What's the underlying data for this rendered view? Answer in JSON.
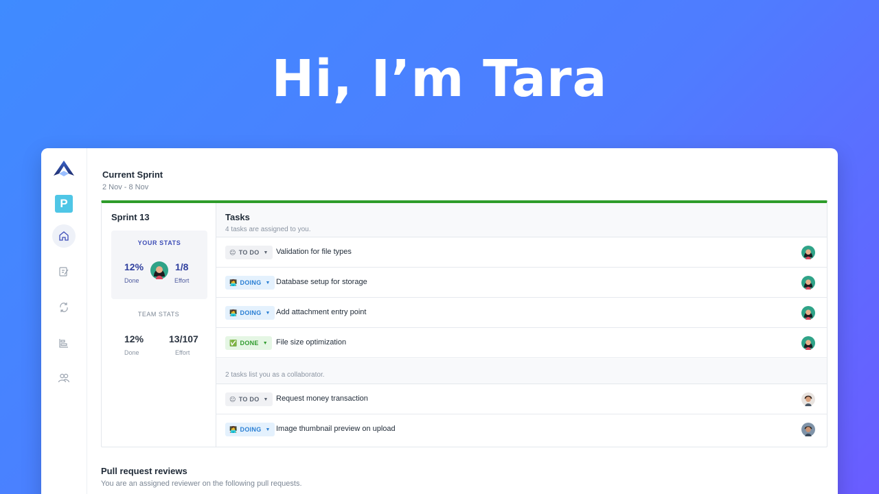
{
  "hero": {
    "title": "Hi, I’m Tara"
  },
  "sidebar": {
    "items": [
      {
        "name": "logo",
        "icon": "app-logo-icon"
      },
      {
        "name": "project",
        "icon": "project-p-icon",
        "label": "P"
      },
      {
        "name": "home",
        "icon": "home-icon"
      },
      {
        "name": "edit",
        "icon": "edit-icon"
      },
      {
        "name": "sync",
        "icon": "sync-icon"
      },
      {
        "name": "roadmap",
        "icon": "roadmap-icon"
      },
      {
        "name": "team",
        "icon": "team-icon"
      }
    ]
  },
  "sprint": {
    "title": "Current Sprint",
    "dates": "2 Nov - 8 Nov",
    "name": "Sprint 13",
    "accent": "#2e9c2a"
  },
  "your_stats": {
    "label": "YOUR STATS",
    "done_value": "12%",
    "done_label": "Done",
    "effort_value": "1/8",
    "effort_label": "Effort"
  },
  "team_stats": {
    "label": "TEAM STATS",
    "done_value": "12%",
    "done_label": "Done",
    "effort_value": "13/107",
    "effort_label": "Effort"
  },
  "tasks": {
    "title": "Tasks",
    "assigned_text": "4 tasks are assigned to you.",
    "assigned": [
      {
        "status": "TO DO",
        "emoji": "😐",
        "title": "Validation for file types"
      },
      {
        "status": "DOING",
        "emoji": "👩‍💻",
        "title": "Database setup for storage"
      },
      {
        "status": "DOING",
        "emoji": "👩‍💻",
        "title": "Add attachment entry point"
      },
      {
        "status": "DONE",
        "emoji": "✅",
        "title": "File size optimization"
      }
    ],
    "collab_text": "2 tasks list you as a collaborator.",
    "collaborator": [
      {
        "status": "TO DO",
        "emoji": "😐",
        "title": "Request money transaction"
      },
      {
        "status": "DOING",
        "emoji": "👩‍💻",
        "title": "Image thumbnail preview on upload"
      }
    ]
  },
  "pull_requests": {
    "title": "Pull request reviews",
    "subtitle": "You are an assigned reviewer on the following pull requests."
  },
  "colors": {
    "todo": "#5b6472",
    "doing": "#2a7fd4",
    "done": "#2f9b2d",
    "your_stats": "#2f3f9e"
  }
}
